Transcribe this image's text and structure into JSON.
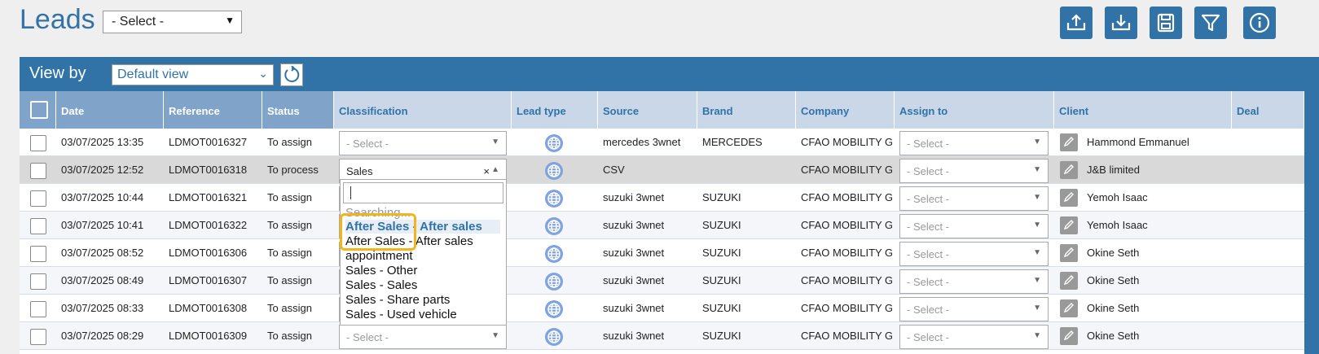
{
  "page_title": "Leads",
  "top_select": "- Select -",
  "toolbar": [
    "upload-icon",
    "download-icon",
    "save-icon",
    "filter-icon",
    "info-icon"
  ],
  "view_by": {
    "label": "View by",
    "value": "Default view"
  },
  "columns": [
    "Date",
    "Reference",
    "Status",
    "Classification",
    "Lead type",
    "Source",
    "Brand",
    "Company",
    "Assign to",
    "Client",
    "Deal"
  ],
  "select_placeholder": "- Select -",
  "rows": [
    {
      "date": "03/07/2025 13:35",
      "ref": "LDMOT0016327",
      "status": "To assign",
      "classification": "- Select -",
      "source": "mercedes 3wnet",
      "brand": "MERCEDES",
      "company": "CFAO MOBILITY GI",
      "assign": "- Select -",
      "client": "Hammond Emmanuel"
    },
    {
      "date": "03/07/2025 12:52",
      "ref": "LDMOT0016318",
      "status": "To process",
      "classification": "Sales",
      "source": "CSV",
      "brand": "",
      "company": "CFAO MOBILITY GI",
      "assign": "- Select -",
      "client": "J&B limited"
    },
    {
      "date": "03/07/2025 10:44",
      "ref": "LDMOT0016321",
      "status": "To assign",
      "classification": "",
      "source": "suzuki 3wnet",
      "brand": "SUZUKI",
      "company": "CFAO MOBILITY GI",
      "assign": "- Select -",
      "client": "Yemoh Isaac"
    },
    {
      "date": "03/07/2025 10:41",
      "ref": "LDMOT0016322",
      "status": "To assign",
      "classification": "",
      "source": "suzuki 3wnet",
      "brand": "SUZUKI",
      "company": "CFAO MOBILITY GI",
      "assign": "- Select -",
      "client": "Yemoh Isaac"
    },
    {
      "date": "03/07/2025 08:52",
      "ref": "LDMOT0016306",
      "status": "To assign",
      "classification": "",
      "source": "suzuki 3wnet",
      "brand": "SUZUKI",
      "company": "CFAO MOBILITY GI",
      "assign": "- Select -",
      "client": "Okine Seth"
    },
    {
      "date": "03/07/2025 08:49",
      "ref": "LDMOT0016307",
      "status": "To assign",
      "classification": "",
      "source": "suzuki 3wnet",
      "brand": "SUZUKI",
      "company": "CFAO MOBILITY GI",
      "assign": "- Select -",
      "client": "Okine Seth"
    },
    {
      "date": "03/07/2025 08:33",
      "ref": "LDMOT0016308",
      "status": "To assign",
      "classification": "",
      "source": "suzuki 3wnet",
      "brand": "SUZUKI",
      "company": "CFAO MOBILITY GI",
      "assign": "- Select -",
      "client": "Okine Seth"
    },
    {
      "date": "03/07/2025 08:29",
      "ref": "LDMOT0016309",
      "status": "To assign",
      "classification": "- Select -",
      "source": "suzuki 3wnet",
      "brand": "SUZUKI",
      "company": "CFAO MOBILITY GI",
      "assign": "- Select -",
      "client": "Okine Seth"
    }
  ],
  "dropdown": {
    "searching": "Searching...",
    "options": [
      "After Sales - After sales",
      "After Sales - After sales",
      "appointment",
      "Sales - Other",
      "Sales - Sales",
      "Sales - Share parts",
      "Sales - Used vehicle"
    ],
    "clear_symbol": "×",
    "up_symbol": "▲"
  },
  "colors": {
    "primary": "#3173a7",
    "header_dark": "#7fa3c9",
    "header_light": "#c9d7e8",
    "annotation": "#f3b51e"
  }
}
